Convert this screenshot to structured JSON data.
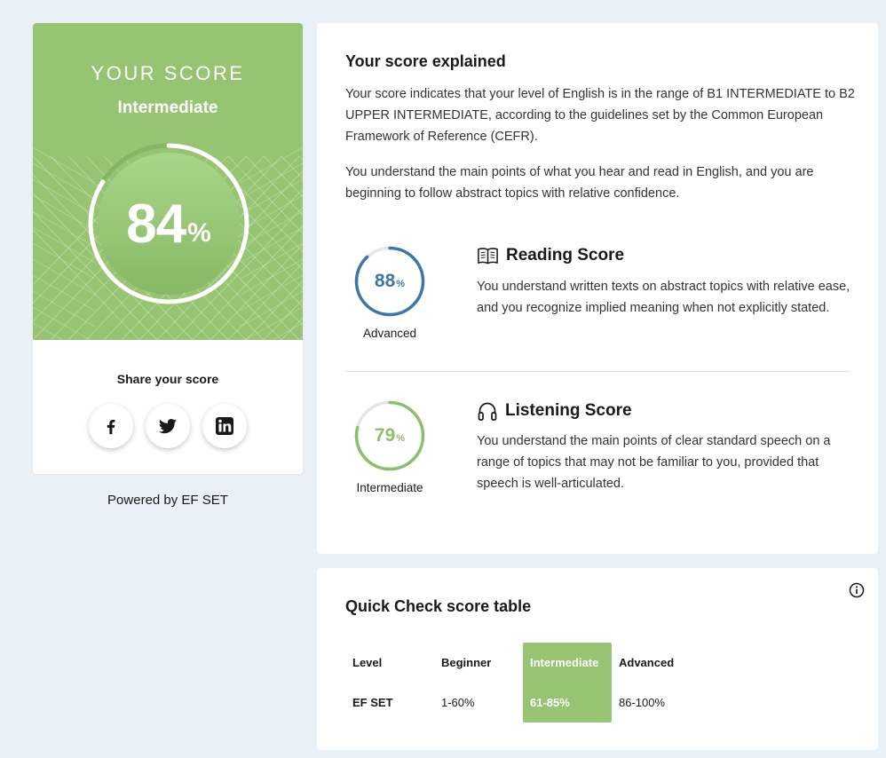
{
  "score_card": {
    "heading": "YOUR SCORE",
    "level": "Intermediate",
    "percent": "84",
    "percent_unit": "%",
    "percent_value": 84,
    "share_label": "Share your score",
    "social": [
      {
        "name": "facebook-icon",
        "glyph": "f"
      },
      {
        "name": "twitter-icon",
        "glyph": "twitter"
      },
      {
        "name": "linkedin-icon",
        "glyph": "in"
      }
    ],
    "accent_color": "#97c472"
  },
  "powered_by": "Powered by EF SET",
  "explanation": {
    "title": "Your score explained",
    "paragraph1": "Your score indicates that your level of English is in the range of B1 INTERMEDIATE to B2 UPPER INTERMEDIATE, according to the guidelines set by the Common European Framework of Reference (CEFR).",
    "paragraph2": "You understand the main points of what you hear and read in English, and you are beginning to follow abstract topics with relative confidence.",
    "reading": {
      "icon": "book-icon",
      "title": "Reading Score",
      "percent": "88",
      "unit": "%",
      "percent_value": 88,
      "level": "Advanced",
      "color": "#3b78a8",
      "description": "You understand written texts on abstract topics with relative ease, and you recognize implied meaning when not explicitly stated."
    },
    "listening": {
      "icon": "headphones-icon",
      "title": "Listening Score",
      "percent": "79",
      "unit": "%",
      "percent_value": 79,
      "level": "Intermediate",
      "color": "#8dbf6a",
      "description": "You understand the main points of clear standard speech on a range of topics that may not be familiar to you, provided that speech is well-articulated."
    }
  },
  "score_table": {
    "title": "Quick Check score table",
    "row_labels": [
      "Level",
      "EF SET"
    ],
    "columns": [
      {
        "level": "Beginner",
        "range": "1-60%"
      },
      {
        "level": "Intermediate",
        "range": "61-85%",
        "highlighted": true
      },
      {
        "level": "Advanced",
        "range": "86-100%"
      }
    ]
  }
}
